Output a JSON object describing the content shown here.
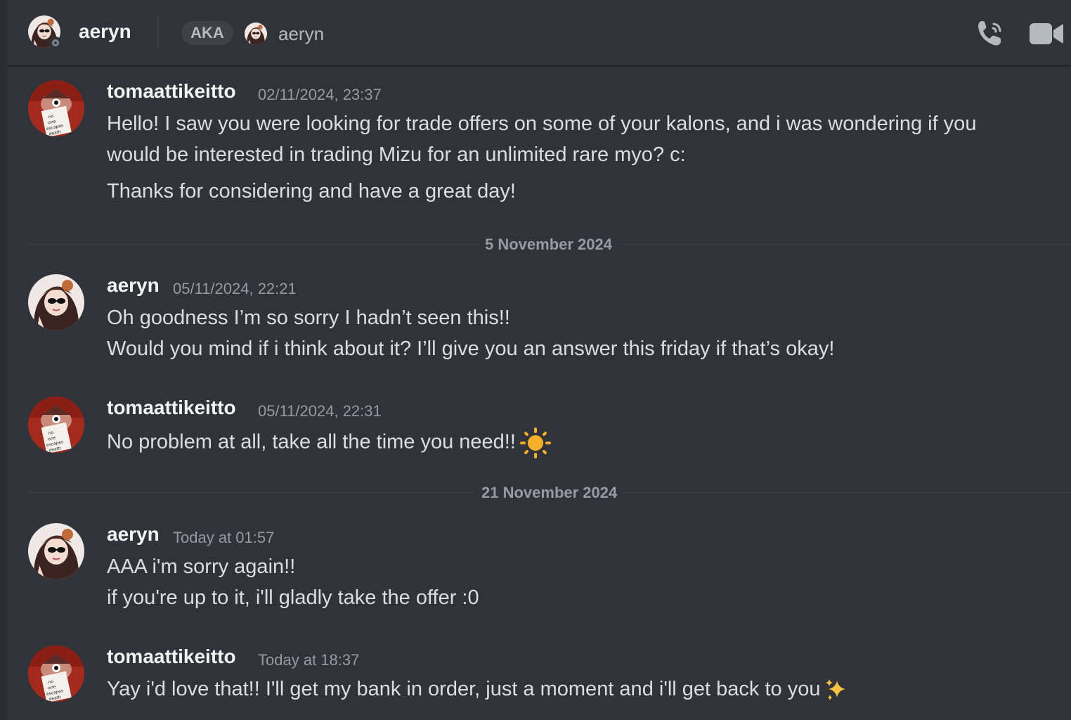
{
  "header": {
    "name": "aeryn",
    "aka_label": "AKA",
    "aka_name": "aeryn",
    "status": "offline"
  },
  "dividers": [
    "5 November 2024",
    "21 November 2024"
  ],
  "messages": [
    {
      "author": "tomaattikeitto",
      "time": "02/11/2024, 23:37",
      "lines": [
        "Hello! I saw you were looking for trade offers on some of your kalons, and i was wondering if you",
        "would be interested in trading Mizu for an unlimited rare myo? c:",
        "Thanks for considering and have a great day!"
      ]
    },
    {
      "author": "aeryn",
      "time": "05/11/2024, 22:21",
      "lines": [
        "Oh goodness I’m so sorry I hadn’t seen this!!",
        "Would you mind if i think about it? I’ll give you an answer this friday if that’s okay!"
      ]
    },
    {
      "author": "tomaattikeitto",
      "time": "05/11/2024, 22:31",
      "lines": [
        "No problem at all, take all the time you need!!"
      ],
      "emoji": "sun-emoji"
    },
    {
      "author": "aeryn",
      "time": "Today at 01:57",
      "lines": [
        "AAA i'm sorry again!!",
        "if you're up to it, i'll gladly take the offer :0"
      ]
    },
    {
      "author": "tomaattikeitto",
      "time": "Today at 18:37",
      "lines": [
        "Yay i'd love that!! I'll get my bank in order, just a moment and i'll get back to you"
      ],
      "emoji": "sparkles-emoji"
    }
  ],
  "colors": {
    "background": "#313338",
    "text": "#dbdee1",
    "username": "#f2f3f5",
    "muted": "#949ba4"
  },
  "icons": [
    "call-icon",
    "video-call-icon"
  ]
}
